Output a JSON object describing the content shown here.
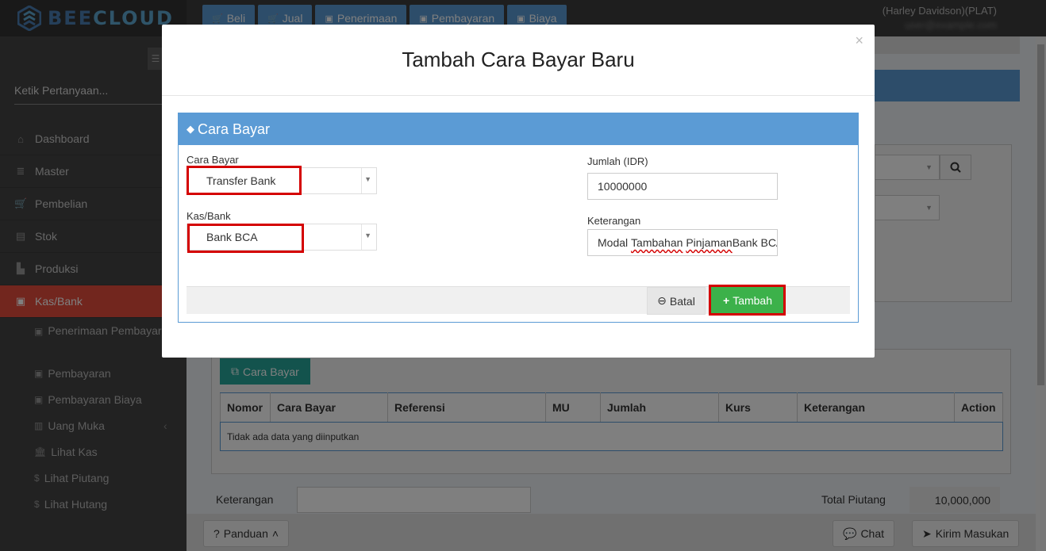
{
  "app": {
    "brand_part1": "BEE",
    "brand_part2": "CLOUD",
    "user_name": "(Harley Davidson)(PLAT)",
    "user_email": "user@example.com"
  },
  "top_tabs": [
    {
      "label": "Beli",
      "icon": "cart-icon"
    },
    {
      "label": "Jual",
      "icon": "cart-icon"
    },
    {
      "label": "Penerimaan",
      "icon": "money-icon"
    },
    {
      "label": "Pembayaran",
      "icon": "money-icon"
    },
    {
      "label": "Biaya",
      "icon": "money-icon"
    }
  ],
  "sidebar": {
    "search_placeholder": "Ketik Pertanyaan...",
    "items": [
      {
        "label": "Dashboard",
        "icon": "home-icon"
      },
      {
        "label": "Master",
        "icon": "database-icon"
      },
      {
        "label": "Pembelian",
        "icon": "cart-icon"
      },
      {
        "label": "Stok",
        "icon": "box-icon"
      },
      {
        "label": "Produksi",
        "icon": "chart-icon"
      },
      {
        "label": "Kas/Bank",
        "icon": "money-icon",
        "active": true
      }
    ],
    "sub_items": [
      {
        "label": "Penerimaan Pembayaran",
        "icon": "money-icon"
      },
      {
        "label": "Pembayaran",
        "icon": "money-icon"
      },
      {
        "label": "Pembayaran Biaya",
        "icon": "money-icon"
      },
      {
        "label": "Uang Muka",
        "icon": "document-icon"
      },
      {
        "label": "Lihat Kas",
        "icon": "bank-icon"
      },
      {
        "label": "Lihat Piutang",
        "icon": "dollar-icon"
      },
      {
        "label": "Lihat Hutang",
        "icon": "dollar-icon"
      }
    ]
  },
  "page": {
    "cara_bayar_button": "Cara Bayar",
    "table": {
      "columns": [
        "Nomor",
        "Cara Bayar",
        "Referensi",
        "MU",
        "Jumlah",
        "Kurs",
        "Keterangan",
        "Action"
      ],
      "empty_text": "Tidak ada data yang diinputkan"
    },
    "keterangan_label": "Keterangan",
    "total_piutang_label": "Total Piutang",
    "total_piutang_value": "10,000,000",
    "panduan_label": "Panduan",
    "chat_label": "Chat",
    "kirim_masukan_label": "Kirim Masukan"
  },
  "modal": {
    "title": "Tambah Cara Bayar Baru",
    "card_title": "Cara Bayar",
    "fields": {
      "cara_bayar_label": "Cara Bayar",
      "cara_bayar_value": "Transfer Bank",
      "kas_bank_label": "Kas/Bank",
      "kas_bank_value": "Bank BCA",
      "jumlah_label": "Jumlah (IDR)",
      "jumlah_value": "10000000",
      "keterangan_label": "Keterangan",
      "keterangan_value_pre": "Modal ",
      "keterangan_value_w1": "Tambahan",
      "keterangan_value_mid": " ",
      "keterangan_value_w2": "Pinjaman",
      "keterangan_value_post": " Bank BCA"
    },
    "batal_label": "Batal",
    "tambah_label": "Tambah"
  },
  "colors": {
    "primary": "#5b9bd5",
    "danger": "#e44c3c",
    "success": "#3cb14a",
    "teal": "#26a69a",
    "highlight": "#d40000"
  }
}
